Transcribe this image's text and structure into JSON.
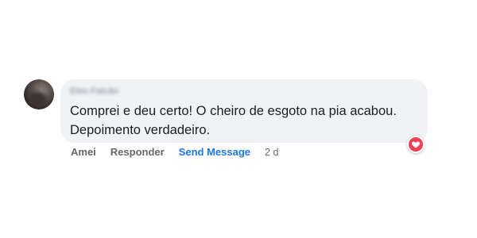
{
  "comment": {
    "author_name": "Elen Falcão",
    "text": "Comprei e deu certo! O cheiro de esgoto na pia acabou. Depoimento verdadeiro.",
    "reaction_icon": "heart-icon",
    "reaction_color": "#f33e58"
  },
  "actions": {
    "like_label": "Amei",
    "reply_label": "Responder",
    "send_message_label": "Send Message",
    "timestamp": "2 d"
  },
  "colors": {
    "bubble_background": "#f0f2f5",
    "link_blue": "#1877f2",
    "muted_text": "#65676b"
  }
}
